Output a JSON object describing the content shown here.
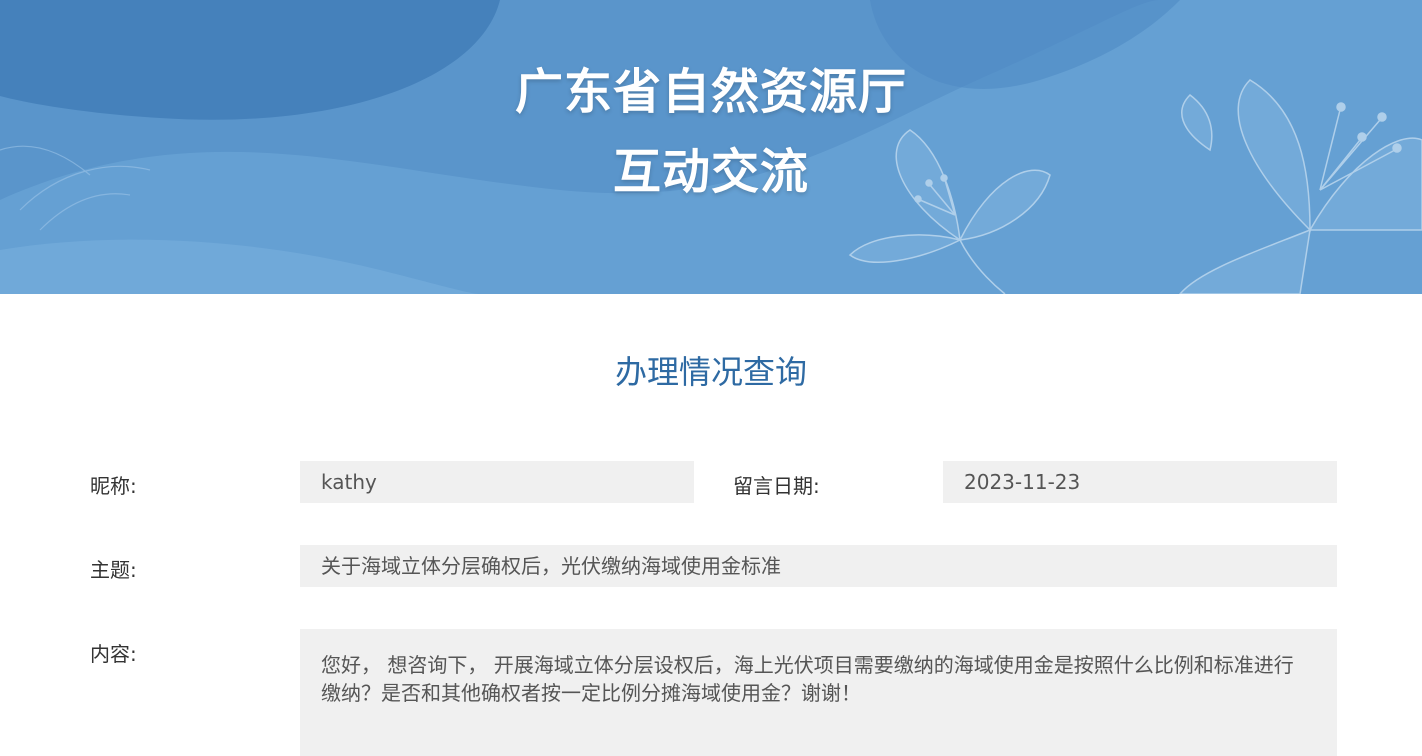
{
  "header": {
    "title_line1": "广东省自然资源厅",
    "title_line2": "互动交流",
    "background_color": "#5a95cb"
  },
  "section": {
    "title": "办理情况查询"
  },
  "form": {
    "nickname_label": "昵称:",
    "nickname_value": "kathy",
    "date_label": "留言日期:",
    "date_value": "2023-11-23",
    "subject_label": "主题:",
    "subject_value": "关于海域立体分层确权后，光伏缴纳海域使用金标准",
    "content_label": "内容:",
    "content_value": "您好， 想咨询下， 开展海域立体分层设权后，海上光伏项目需要缴纳的海域使用金是按照什么比例和标准进行缴纳？是否和其他确权者按一定比例分摊海域使用金？谢谢！"
  },
  "colors": {
    "accent": "#2e6aa3",
    "field_bg": "#f0f0f0"
  }
}
